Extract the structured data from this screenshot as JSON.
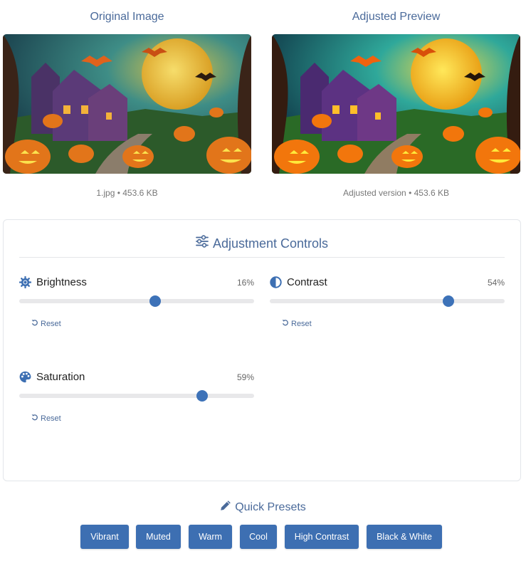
{
  "original": {
    "title": "Original Image",
    "caption": "1.jpg • 453.6 KB",
    "image_name": "halloween-scene-image"
  },
  "adjusted": {
    "title": "Adjusted Preview",
    "caption": "Adjusted version • 453.6 KB",
    "image_name": "halloween-scene-adjusted"
  },
  "panel": {
    "title": "Adjustment Controls",
    "icon": "sliders-icon",
    "controls": {
      "brightness": {
        "label": "Brightness",
        "value_text": "16%",
        "slider_fraction": 0.58,
        "icon": "sun-gear-icon",
        "reset_label": "Reset"
      },
      "contrast": {
        "label": "Contrast",
        "value_text": "54%",
        "slider_fraction": 0.76,
        "icon": "half-circle-icon",
        "reset_label": "Reset"
      },
      "saturation": {
        "label": "Saturation",
        "value_text": "59%",
        "slider_fraction": 0.78,
        "icon": "palette-icon",
        "reset_label": "Reset"
      }
    }
  },
  "presets": {
    "title": "Quick Presets",
    "icon": "pencil-icon",
    "buttons": [
      "Vibrant",
      "Muted",
      "Warm",
      "Cool",
      "High Contrast",
      "Black & White"
    ]
  },
  "colors": {
    "accent": "#3d72b8",
    "heading": "#4a6a9a",
    "button": "#3d6fb2"
  }
}
